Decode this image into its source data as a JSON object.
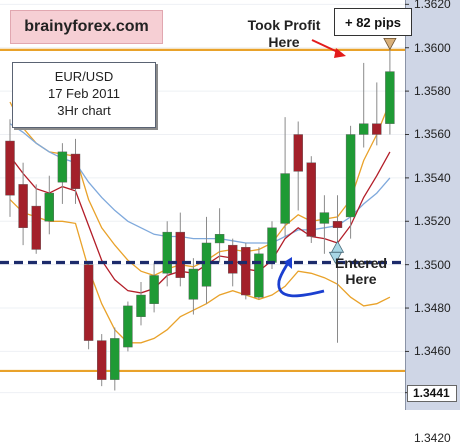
{
  "chart_data": {
    "type": "candlestick",
    "pair": "EUR/USD",
    "date": "17 Feb 2011",
    "timeframe": "3Hr chart",
    "ylim": [
      1.3433,
      1.3622
    ],
    "y_ticks": [
      "1.3620",
      "1.3600",
      "1.3580",
      "1.3560",
      "1.3540",
      "1.3520",
      "1.3500",
      "1.3480",
      "1.3460",
      "1.3441",
      "1.3420"
    ],
    "highlighted_tick": "1.3441",
    "levels": {
      "resistance": 1.3599,
      "entry": 1.3501,
      "support": 1.3451
    },
    "candles": [
      {
        "o": 1.3557,
        "h": 1.3567,
        "l": 1.3522,
        "c": 1.3532
      },
      {
        "o": 1.3537,
        "h": 1.3547,
        "l": 1.3509,
        "c": 1.3517
      },
      {
        "o": 1.3527,
        "h": 1.3537,
        "l": 1.3505,
        "c": 1.3507
      },
      {
        "o": 1.352,
        "h": 1.3541,
        "l": 1.3514,
        "c": 1.3533
      },
      {
        "o": 1.3538,
        "h": 1.3556,
        "l": 1.3528,
        "c": 1.3552
      },
      {
        "o": 1.3551,
        "h": 1.3558,
        "l": 1.3528,
        "c": 1.3535
      },
      {
        "o": 1.35,
        "h": 1.3501,
        "l": 1.3461,
        "c": 1.3465
      },
      {
        "o": 1.3465,
        "h": 1.3468,
        "l": 1.3444,
        "c": 1.3447
      },
      {
        "o": 1.3447,
        "h": 1.3471,
        "l": 1.3442,
        "c": 1.3466
      },
      {
        "o": 1.3462,
        "h": 1.3483,
        "l": 1.346,
        "c": 1.3481
      },
      {
        "o": 1.3476,
        "h": 1.3492,
        "l": 1.3472,
        "c": 1.3486
      },
      {
        "o": 1.3482,
        "h": 1.3501,
        "l": 1.3478,
        "c": 1.3495
      },
      {
        "o": 1.3496,
        "h": 1.352,
        "l": 1.349,
        "c": 1.3515
      },
      {
        "o": 1.3515,
        "h": 1.3524,
        "l": 1.349,
        "c": 1.3494
      },
      {
        "o": 1.3484,
        "h": 1.3503,
        "l": 1.3477,
        "c": 1.3498
      },
      {
        "o": 1.349,
        "h": 1.3522,
        "l": 1.3482,
        "c": 1.351
      },
      {
        "o": 1.351,
        "h": 1.3526,
        "l": 1.3501,
        "c": 1.3514
      },
      {
        "o": 1.3509,
        "h": 1.3512,
        "l": 1.349,
        "c": 1.3496
      },
      {
        "o": 1.3508,
        "h": 1.351,
        "l": 1.3484,
        "c": 1.3486
      },
      {
        "o": 1.3485,
        "h": 1.3508,
        "l": 1.3484,
        "c": 1.3505
      },
      {
        "o": 1.3501,
        "h": 1.352,
        "l": 1.3498,
        "c": 1.3517
      },
      {
        "o": 1.3519,
        "h": 1.3568,
        "l": 1.3513,
        "c": 1.3542
      },
      {
        "o": 1.356,
        "h": 1.3566,
        "l": 1.3525,
        "c": 1.3543
      },
      {
        "o": 1.3547,
        "h": 1.355,
        "l": 1.351,
        "c": 1.3513
      },
      {
        "o": 1.3519,
        "h": 1.3532,
        "l": 1.3505,
        "c": 1.3524
      },
      {
        "o": 1.352,
        "h": 1.3532,
        "l": 1.3464,
        "c": 1.3517
      },
      {
        "o": 1.3522,
        "h": 1.3564,
        "l": 1.3512,
        "c": 1.356
      },
      {
        "o": 1.356,
        "h": 1.3593,
        "l": 1.3554,
        "c": 1.3565
      },
      {
        "o": 1.3565,
        "h": 1.3584,
        "l": 1.3555,
        "c": 1.356
      },
      {
        "o": 1.3565,
        "h": 1.36,
        "l": 1.356,
        "c": 1.3589
      }
    ],
    "indicators": [
      {
        "color": "#e9a22a",
        "values": [
          1.3575,
          1.3563,
          1.3556,
          1.3552,
          1.3551,
          1.355,
          1.353,
          1.3517,
          1.3509,
          1.3502,
          1.3497,
          1.3495,
          1.3498,
          1.35,
          1.3499,
          1.3502,
          1.3506,
          1.3507,
          1.3506,
          1.3507,
          1.351,
          1.3518,
          1.3523,
          1.352,
          1.3521,
          1.3522,
          1.353,
          1.3548,
          1.356,
          1.3575
        ]
      },
      {
        "color": "#7fa9dc",
        "values": [
          1.3565,
          1.3561,
          1.3556,
          1.3552,
          1.3549,
          1.3547,
          1.3538,
          1.3531,
          1.3525,
          1.352,
          1.3517,
          1.3514,
          1.3513,
          1.3513,
          1.3512,
          1.3512,
          1.3512,
          1.3511,
          1.351,
          1.351,
          1.351,
          1.3513,
          1.3516,
          1.3516,
          1.3517,
          1.3518,
          1.3522,
          1.3528,
          1.3533,
          1.354
        ]
      },
      {
        "color": "#b31d28",
        "values": [
          1.355,
          1.3542,
          1.3535,
          1.3533,
          1.3536,
          1.3534,
          1.3518,
          1.3502,
          1.3493,
          1.3488,
          1.3487,
          1.3489,
          1.3495,
          1.3497,
          1.3496,
          1.35,
          1.3504,
          1.3503,
          1.3498,
          1.3497,
          1.3502,
          1.3512,
          1.3517,
          1.3513,
          1.3512,
          1.351,
          1.3518,
          1.3531,
          1.3541,
          1.3552
        ]
      },
      {
        "color": "#e9a22a",
        "values": [
          1.353,
          1.3524,
          1.3522,
          1.352,
          1.352,
          1.3519,
          1.3498,
          1.3482,
          1.347,
          1.3464,
          1.3464,
          1.3466,
          1.347,
          1.3476,
          1.3479,
          1.3482,
          1.3486,
          1.3488,
          1.3486,
          1.3484,
          1.3486,
          1.349,
          1.3497,
          1.3496,
          1.3494,
          1.3491,
          1.3485,
          1.3481,
          1.3482,
          1.3485
        ]
      }
    ],
    "entry_marker": {
      "index": 25,
      "price": 1.3508,
      "kind": "triangle-up"
    },
    "exit_marker": {
      "index": 29,
      "price": 1.3602,
      "kind": "triangle-down"
    }
  },
  "labels": {
    "brand": "brainyforex.com",
    "pair": "EUR/USD",
    "date": "17 Feb 2011",
    "timeframe": "3Hr chart",
    "pips": "+ 82 pips",
    "took_profit_1": "Took Profit",
    "took_profit_2": "Here",
    "entered_1": "Entered",
    "entered_2": "Here"
  },
  "colors": {
    "bull_body": "#1f9a35",
    "bear_body": "#a3202a",
    "wick": "#8a8a8a",
    "level_line": "#e9a22a",
    "entry_line": "#1c2b6b",
    "marker_fill": "#a8d7e6",
    "exit_fill": "#d9b07a",
    "arrow_red": "#e31b1b",
    "arrow_blue": "#1b3fd0"
  }
}
